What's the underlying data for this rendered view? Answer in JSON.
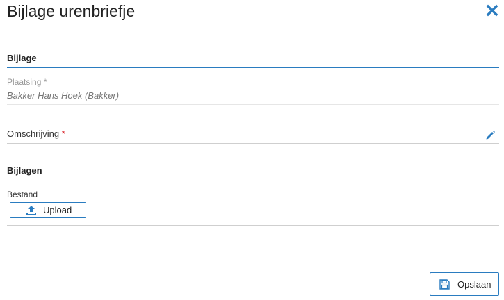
{
  "dialog": {
    "title": "Bijlage urenbriefje",
    "close_icon": "close-icon"
  },
  "sections": {
    "bijlage_title": "Bijlage",
    "bijlagen_title": "Bijlagen"
  },
  "plaatsing": {
    "label": "Plaatsing",
    "required_marker": "*",
    "value": "Bakker Hans Hoek (Bakker)"
  },
  "omschrijving": {
    "label": "Omschrijving",
    "required_marker": "*",
    "edit_icon": "pencil-icon"
  },
  "bestand": {
    "label": "Bestand",
    "upload_label": "Upload",
    "upload_icon": "upload-icon"
  },
  "footer": {
    "save_label": "Opslaan",
    "save_icon": "floppy-disk-icon"
  },
  "colors": {
    "accent": "#2a7cc0",
    "required": "#d9262c"
  }
}
